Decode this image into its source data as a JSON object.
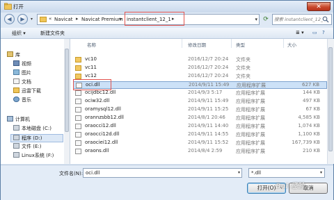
{
  "window": {
    "title": "打开",
    "close_symbol": "✕"
  },
  "address": {
    "crumbs": [
      "Navicat",
      "Navicat Premium",
      "instantclient_12_1"
    ],
    "search_placeholder": "搜索 instantclient_12_1"
  },
  "toolbar": {
    "organize": "组织 ▾",
    "new_folder": "新建文件夹",
    "view": "≣ ▾"
  },
  "nav": {
    "items": [
      "库",
      "视频",
      "图片",
      "文档",
      "迅雷下载",
      "音乐",
      "计算机",
      "本地磁盘 (C:)",
      "程序 (D:)",
      "文件 (E:)",
      "Linux系统 (F:)"
    ]
  },
  "columns": {
    "name": "名称",
    "date": "修改日期",
    "type": "类型",
    "size": "大小"
  },
  "files": [
    {
      "name": "vc10",
      "date": "2016/12/7 20:24",
      "type": "文件夹",
      "size": ""
    },
    {
      "name": "vc11",
      "date": "2016/12/7 20:24",
      "type": "文件夹",
      "size": ""
    },
    {
      "name": "vc12",
      "date": "2016/12/7 20:24",
      "type": "文件夹",
      "size": ""
    },
    {
      "name": "oci.dll",
      "date": "2014/9/11 15:49",
      "type": "应用程序扩展",
      "size": "627 KB"
    },
    {
      "name": "ocijdbc12.dll",
      "date": "2014/9/3 5:17",
      "type": "应用程序扩展",
      "size": "144 KB"
    },
    {
      "name": "ociw32.dll",
      "date": "2014/9/11 15:49",
      "type": "应用程序扩展",
      "size": "497 KB"
    },
    {
      "name": "oramysql12.dll",
      "date": "2014/9/11 15:25",
      "type": "应用程序扩展",
      "size": "67 KB"
    },
    {
      "name": "orannzsbb12.dll",
      "date": "2014/8/1 20:46",
      "type": "应用程序扩展",
      "size": "4,585 KB"
    },
    {
      "name": "oraocci12.dll",
      "date": "2014/9/11 14:40",
      "type": "应用程序扩展",
      "size": "1,074 KB"
    },
    {
      "name": "oraocci12d.dll",
      "date": "2014/9/11 14:55",
      "type": "应用程序扩展",
      "size": "1,100 KB"
    },
    {
      "name": "oraociei12.dll",
      "date": "2014/9/11 15:52",
      "type": "应用程序扩展",
      "size": "167,739 KB"
    },
    {
      "name": "oraons.dll",
      "date": "2014/8/4 2:59",
      "type": "应用程序扩展",
      "size": "210 KB"
    }
  ],
  "bottom": {
    "filename_label": "文件名(N):",
    "filename_value": "oci.dll",
    "filter_value": "*.dll",
    "open_label": "打开(O)",
    "cancel_label": "取消"
  },
  "watermark": "Bai 经验",
  "colors": {
    "highlight": "#e2534e",
    "selection": "#cce1f7",
    "title_bar": "#cad9ec"
  }
}
